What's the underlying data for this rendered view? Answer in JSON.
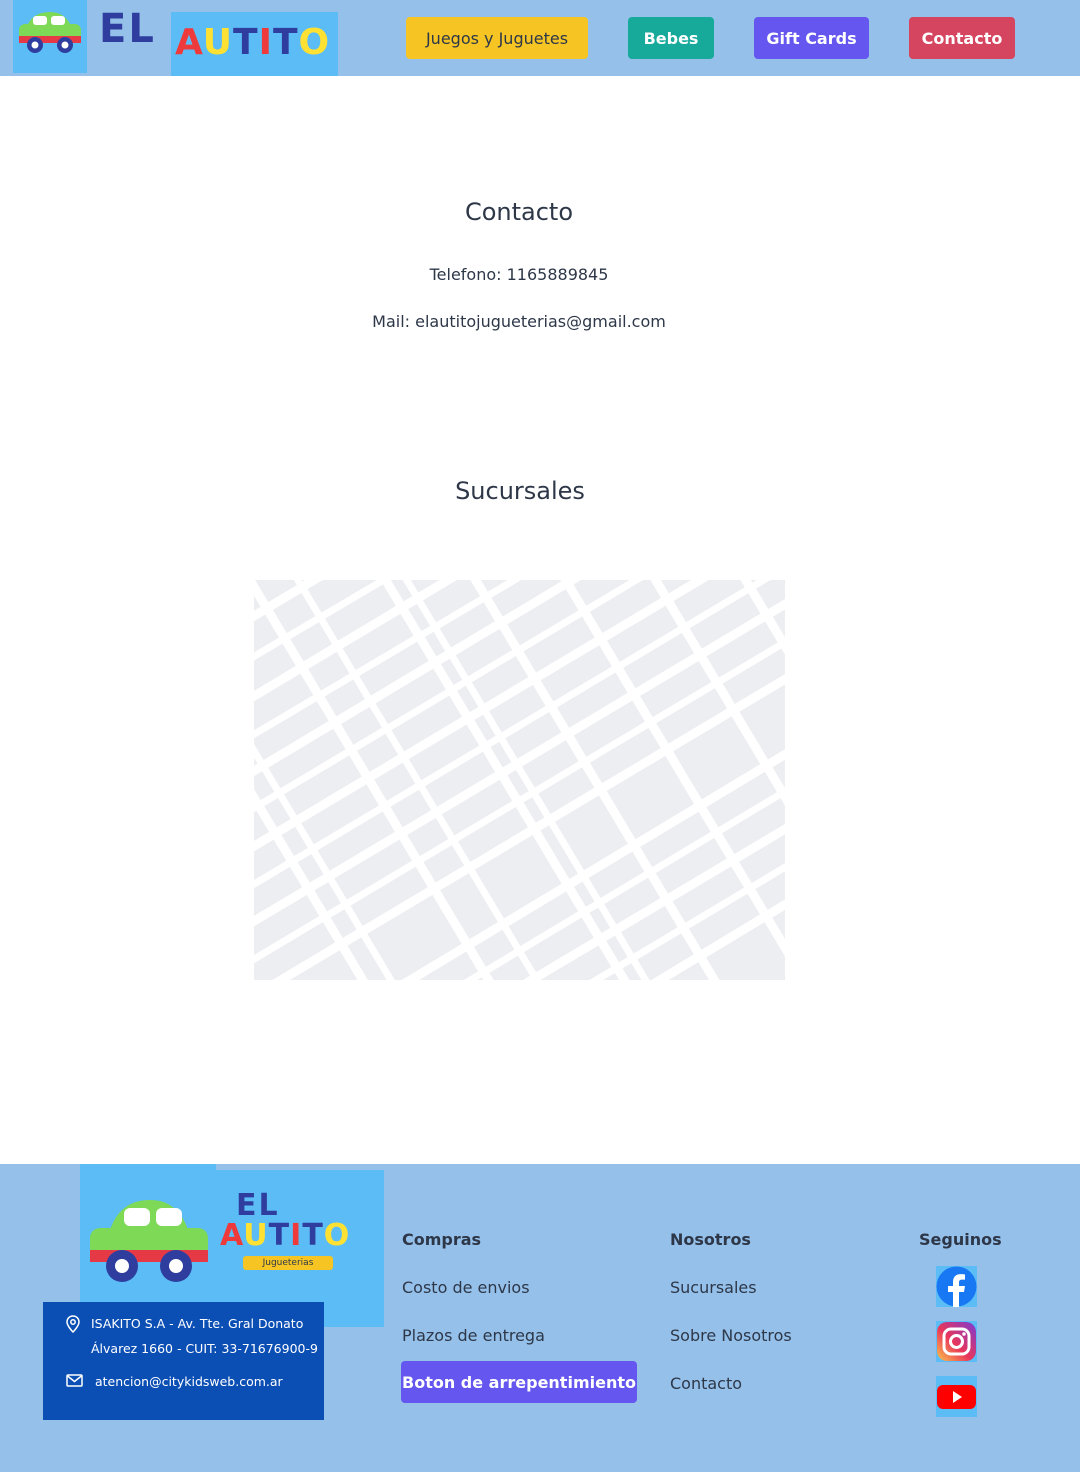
{
  "header": {
    "logo": {
      "el": "EL",
      "autito": "AUTITO"
    },
    "nav": {
      "juegos": "Juegos y Juguetes",
      "bebes": "Bebes",
      "gift_cards": "Gift Cards",
      "contacto": "Contacto"
    }
  },
  "main": {
    "contacto_heading": "Contacto",
    "telefono": "Telefono: 1165889845",
    "mail": "Mail: elautitojugueterias@gmail.com",
    "sucursales_heading": "Sucursales"
  },
  "footer": {
    "logo": {
      "el": "EL",
      "autito": "AUTITO",
      "tagline": "Jugueterias"
    },
    "info": {
      "line1": "ISAKITO S.A - Av. Tte. Gral Donato",
      "line2": "Álvarez 1660 - CUIT: 33-71676900-9",
      "email": "atencion@citykidsweb.com.ar"
    },
    "compras": {
      "title": "Compras",
      "costo_envios": "Costo de envios",
      "plazos": "Plazos de entrega",
      "arrepentimiento": "Boton de arrepentimiento"
    },
    "nosotros": {
      "title": "Nosotros",
      "sucursales": "Sucursales",
      "sobre": "Sobre Nosotros",
      "contacto": "Contacto"
    },
    "seguinos": {
      "title": "Seguinos",
      "icons": [
        "facebook-icon",
        "instagram-icon",
        "youtube-icon"
      ]
    }
  },
  "colors": {
    "header_bg": "#95c0ea",
    "logo_bg": "#5bbcf6",
    "nav_juegos": "#f6c523",
    "nav_bebes": "#17a99a",
    "nav_gift": "#6456ef",
    "nav_contacto": "#d64560",
    "footer_info_bg": "#0b4fb5"
  }
}
